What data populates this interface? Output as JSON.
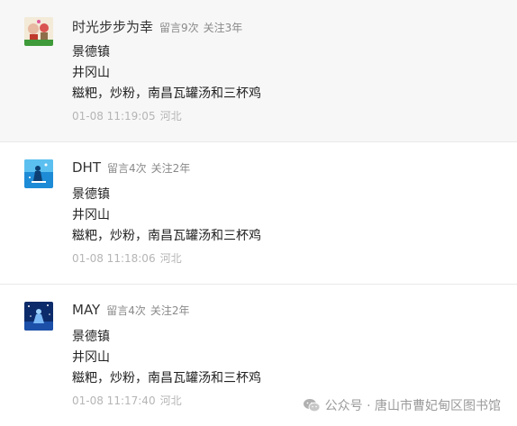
{
  "comments": [
    {
      "nickname": "时光步步为幸",
      "stat_messages": "留言9次",
      "stat_follow": "关注3年",
      "lines": [
        "景德镇",
        "井冈山",
        "糍粑，炒粉，南昌瓦罐汤和三杯鸡"
      ],
      "time": "01-08 11:19:05",
      "location": "河北",
      "avatar_icon": "cartoon-avatar-icon"
    },
    {
      "nickname": "DHT",
      "stat_messages": "留言4次",
      "stat_follow": "关注2年",
      "lines": [
        "景德镇",
        "井冈山",
        "糍粑，炒粉，南昌瓦罐汤和三杯鸡"
      ],
      "time": "01-08 11:18:06",
      "location": "河北",
      "avatar_icon": "blue-figure-avatar-icon"
    },
    {
      "nickname": "MAY",
      "stat_messages": "留言4次",
      "stat_follow": "关注2年",
      "lines": [
        "景德镇",
        "井冈山",
        "糍粑，炒粉，南昌瓦罐汤和三杯鸡"
      ],
      "time": "01-08 11:17:40",
      "location": "河北",
      "avatar_icon": "night-sky-avatar-icon"
    }
  ],
  "watermark": {
    "text": "公众号 · 唐山市曹妃甸区图书馆",
    "icon": "wechat-official-account-icon"
  },
  "colors": {
    "highlight_background": "#f7f7f7",
    "nickname": "#333333",
    "meta": "#8a8a8a",
    "footer": "#b5b5b5"
  }
}
